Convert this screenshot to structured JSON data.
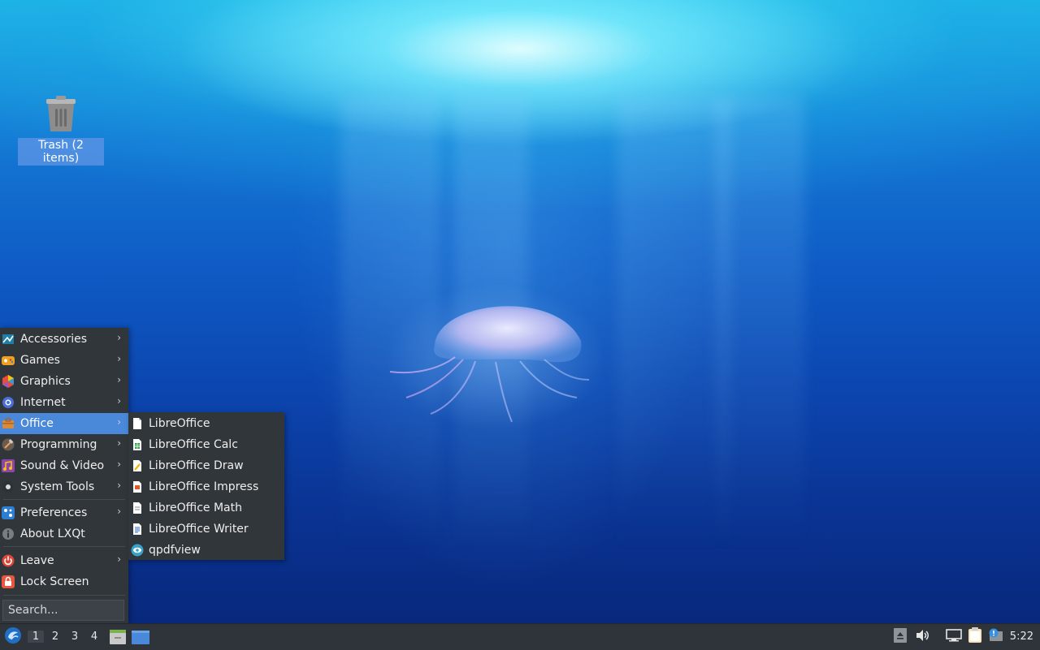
{
  "desktop": {
    "trash_label": "Trash (2 items)"
  },
  "menu": {
    "items": [
      {
        "label": "Accessories",
        "icon": "accessories-icon",
        "submenu": true
      },
      {
        "label": "Games",
        "icon": "games-icon",
        "submenu": true
      },
      {
        "label": "Graphics",
        "icon": "graphics-icon",
        "submenu": true
      },
      {
        "label": "Internet",
        "icon": "internet-icon",
        "submenu": true
      },
      {
        "label": "Office",
        "icon": "office-icon",
        "submenu": true,
        "active": true
      },
      {
        "label": "Programming",
        "icon": "programming-icon",
        "submenu": true
      },
      {
        "label": "Sound & Video",
        "icon": "sound-video-icon",
        "submenu": true
      },
      {
        "label": "System Tools",
        "icon": "system-tools-icon",
        "submenu": true
      },
      {
        "label": "Preferences",
        "icon": "preferences-icon",
        "submenu": true
      },
      {
        "label": "About LXQt",
        "icon": "info-icon",
        "submenu": false
      },
      {
        "label": "Leave",
        "icon": "power-icon",
        "submenu": true
      },
      {
        "label": "Lock Screen",
        "icon": "lock-icon",
        "submenu": false
      }
    ],
    "search_placeholder": "Search...",
    "arrow": "›"
  },
  "office_submenu": {
    "items": [
      {
        "label": "LibreOffice",
        "icon": "libreoffice-icon"
      },
      {
        "label": "LibreOffice Calc",
        "icon": "calc-icon"
      },
      {
        "label": "LibreOffice Draw",
        "icon": "draw-icon"
      },
      {
        "label": "LibreOffice Impress",
        "icon": "impress-icon"
      },
      {
        "label": "LibreOffice Math",
        "icon": "math-icon"
      },
      {
        "label": "LibreOffice Writer",
        "icon": "writer-icon"
      },
      {
        "label": "qpdfview",
        "icon": "qpdfview-icon"
      }
    ]
  },
  "taskbar": {
    "workspaces": [
      "1",
      "2",
      "3",
      "4"
    ],
    "active_workspace": "1",
    "clock": "5:22"
  },
  "colors": {
    "menu_bg": "#31363b",
    "highlight": "#4a88d9",
    "taskbar_bg": "#2f343a"
  }
}
